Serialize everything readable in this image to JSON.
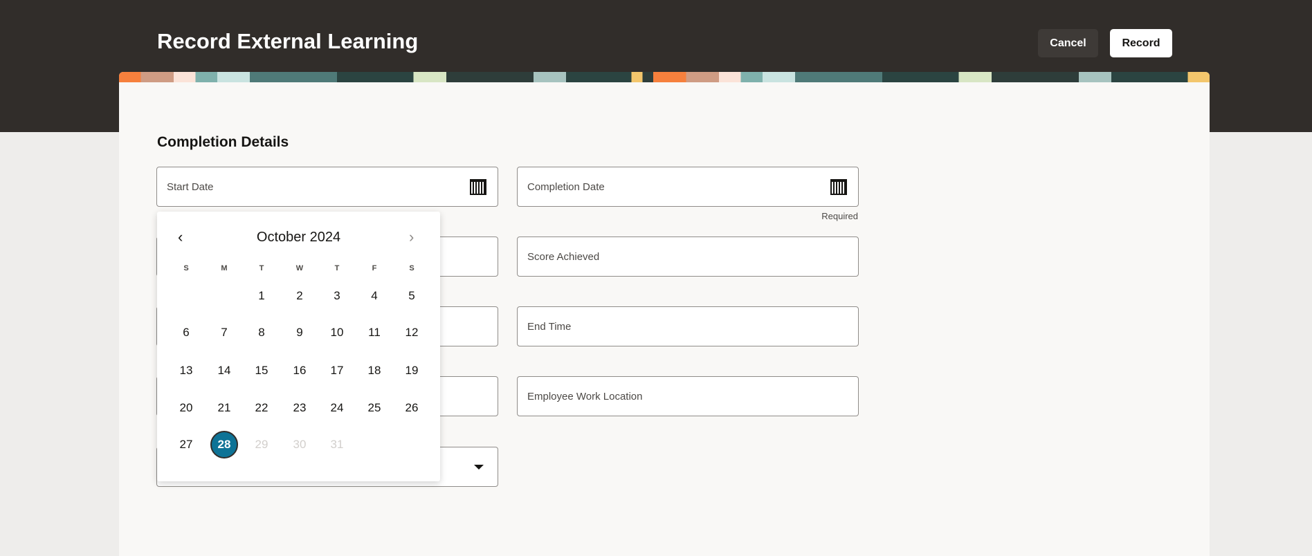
{
  "header": {
    "title": "Record External Learning",
    "cancel": "Cancel",
    "record": "Record"
  },
  "section": {
    "title": "Completion Details"
  },
  "fields": {
    "start_date": "Start Date",
    "completion_date": "Completion Date",
    "required": "Required",
    "score_achieved": "Score Achieved",
    "end_time": "End Time",
    "employee_work_location": "Employee Work Location"
  },
  "calendar": {
    "month": "October 2024",
    "prev": "‹",
    "next": "›",
    "weekdays": [
      "S",
      "M",
      "T",
      "W",
      "T",
      "F",
      "S"
    ],
    "first_weekday": 2,
    "days_in_month": 31,
    "selected": 28,
    "max_enabled": 28
  }
}
